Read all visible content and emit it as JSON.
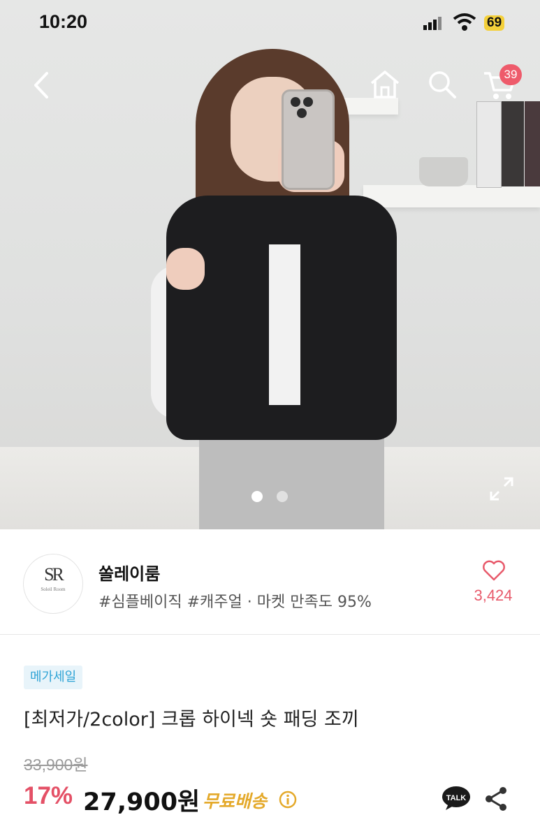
{
  "status_bar": {
    "time": "10:20",
    "battery": "69"
  },
  "nav": {
    "cart_count": "39"
  },
  "gallery": {
    "dot_count": 2,
    "active_index": 0
  },
  "seller": {
    "logo_text": "SR",
    "logo_subtitle": "Soleil Room",
    "name": "쏠레이룸",
    "tags": "#심플베이직 #캐주얼 · 마켓 만족도 95%",
    "likes": "3,424"
  },
  "product": {
    "badge": "메가세일",
    "title": "[최저가/2color] 크롭 하이넥 숏 패딩 조끼",
    "original_price": "33,900원",
    "discount": "17%",
    "price": "27,900원",
    "shipping": "무료배송"
  },
  "actions": {
    "talk_label": "TALK"
  },
  "colors": {
    "accent_pink": "#e45066",
    "badge_blue": "#2fa4d6",
    "shipping_gold": "#e4a92a"
  }
}
